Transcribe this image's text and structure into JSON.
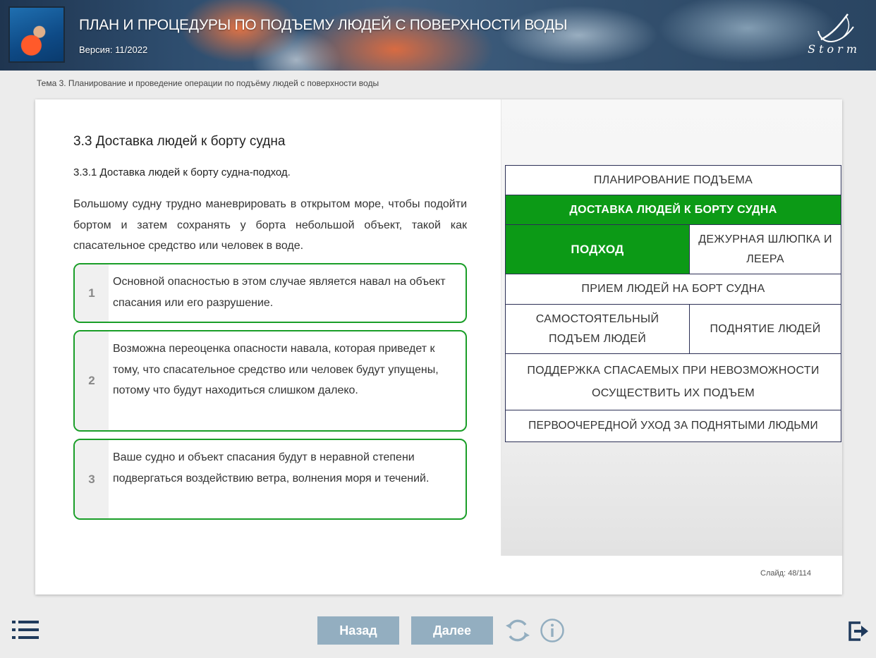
{
  "header": {
    "title": "ПЛАН И ПРОЦЕДУРЫ ПО ПОДЪЕМУ ЛЮДЕЙ С ПОВЕРХНОСТИ ВОДЫ",
    "version": "Версия: 11/2022",
    "logo_text": "Storm"
  },
  "breadcrumb": "Тема 3. Планирование и проведение операции по подъёму людей с поверхности воды",
  "content": {
    "section_title": "3.3 Доставка людей к борту судна",
    "sub_title": "3.3.1 Доставка людей к борту судна-подход.",
    "intro": "Большому судну трудно маневрировать в открытом море, чтобы подойти бортом и затем сохранять у борта небольшой объект, такой как спасательное средство или человек в воде.",
    "cards": [
      {
        "num": "1",
        "text": "Основной опасностью в этом случае является навал на объект спасания или его разрушение."
      },
      {
        "num": "2",
        "text": "Возможна переоценка опасности навала, которая приведет к тому, что спасательное средство или человек будут упущены, потому что будут находиться слишком далеко."
      },
      {
        "num": "3",
        "text": "Ваше судно и объект спасания будут в неравной степени подвергаться воздействию ветра, волнения моря и течений."
      }
    ]
  },
  "nav": {
    "planning": "ПЛАНИРОВАНИЕ ПОДЪЕМА",
    "delivery": "ДОСТАВКА ЛЮДЕЙ К БОРТУ СУДНА",
    "approach": "ПОДХОД",
    "duty_boat": "ДЕЖУРНАЯ ШЛЮПКА И ЛЕЕРА",
    "reception": "ПРИЕМ ЛЮДЕЙ НА БОРТ СУДНА",
    "self_lift": "САМОСТОЯТЕЛЬНЫЙ ПОДЪЕМ ЛЮДЕЙ",
    "lifting": "ПОДНЯТИЕ ЛЮДЕЙ",
    "support": "ПОДДЕРЖКА СПАСАЕМЫХ ПРИ НЕВОЗМОЖНОСТИ ОСУЩЕСТВИТЬ ИХ ПОДЪЕМ",
    "care": "ПЕРВООЧЕРЕДНОЙ УХОД ЗА ПОДНЯТЫМИ ЛЮДЬМИ"
  },
  "slide_counter": "Слайд: 48/114",
  "footer": {
    "back": "Назад",
    "next": "Далее"
  },
  "colors": {
    "accent_green": "#0c9a16",
    "card_border": "#1a9e28",
    "button": "#93aec0"
  }
}
